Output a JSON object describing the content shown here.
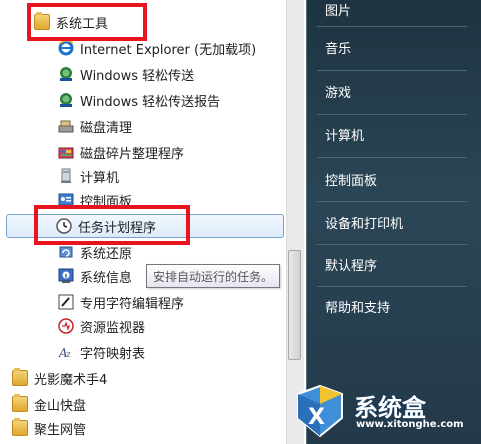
{
  "left_menu": {
    "items": [
      {
        "label": "系统工具"
      },
      {
        "label": "Internet Explorer (无加载项)"
      },
      {
        "label": "Windows 轻松传送"
      },
      {
        "label": "Windows 轻松传送报告"
      },
      {
        "label": "磁盘清理"
      },
      {
        "label": "磁盘碎片整理程序"
      },
      {
        "label": "计算机"
      },
      {
        "label": "控制面板"
      },
      {
        "label": "任务计划程序"
      },
      {
        "label": "系统还原"
      },
      {
        "label": "系统信息"
      },
      {
        "label": "专用字符编辑程序"
      },
      {
        "label": "资源监视器"
      },
      {
        "label": "字符映射表"
      },
      {
        "label": "光影魔术手4"
      },
      {
        "label": "金山快盘"
      },
      {
        "label": "聚生网管"
      }
    ]
  },
  "tooltip": "安排自动运行的任务。",
  "right_menu": {
    "items": [
      {
        "label": "图片"
      },
      {
        "label": "音乐"
      },
      {
        "label": "游戏"
      },
      {
        "label": "计算机"
      },
      {
        "label": "控制面板"
      },
      {
        "label": "设备和打印机"
      },
      {
        "label": "默认程序"
      },
      {
        "label": "帮助和支持"
      }
    ]
  },
  "watermark": {
    "name": "系统盒",
    "url": "www.xitonghe.com"
  },
  "colors": {
    "highlight_box": "#e8141e",
    "right_panel": "#2b4656",
    "selection": "#dcebfc"
  }
}
